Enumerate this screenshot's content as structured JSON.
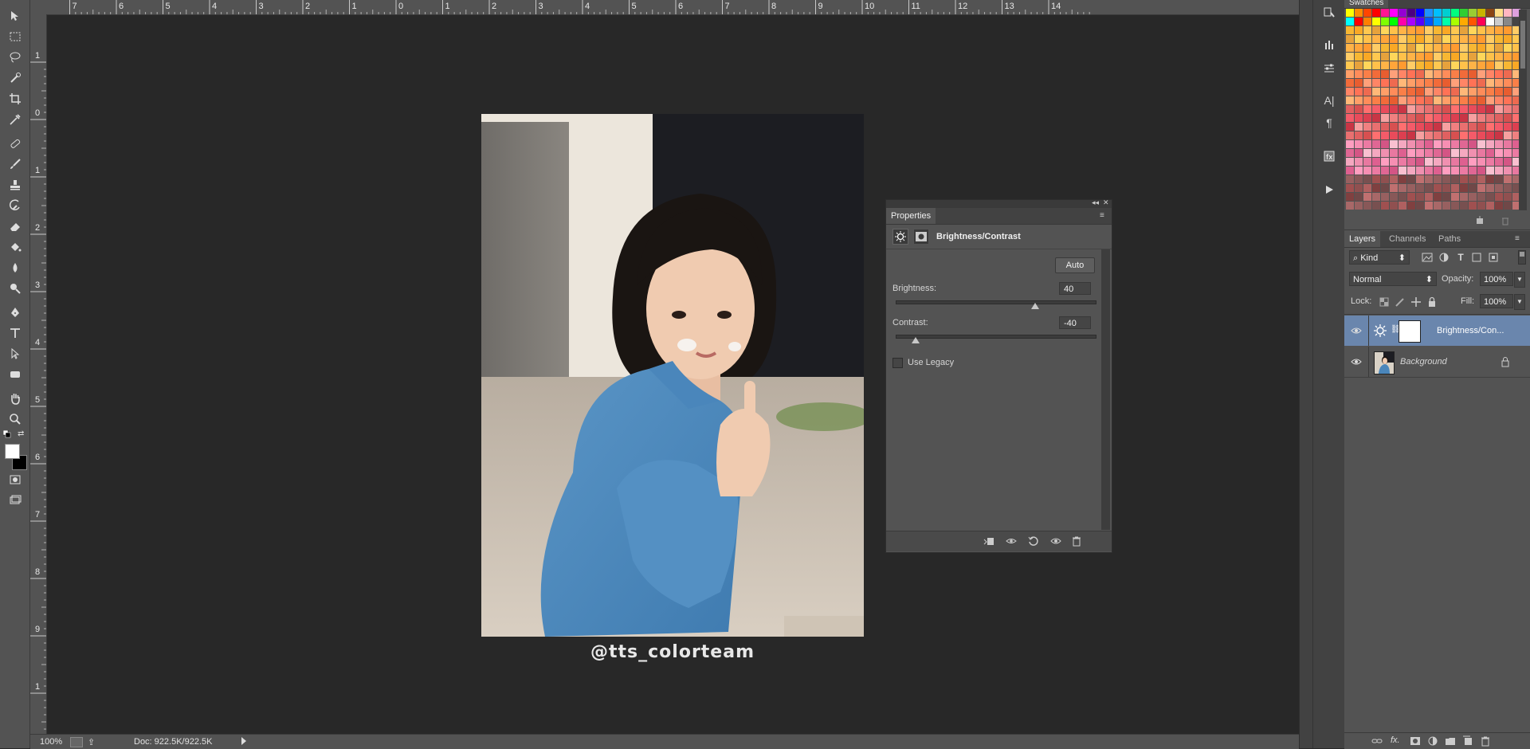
{
  "ruler": {
    "top_labels": [
      "7",
      "6",
      "5",
      "4",
      "3",
      "2",
      "1",
      "0",
      "1",
      "2",
      "3",
      "4",
      "5",
      "6",
      "7",
      "8",
      "9",
      "10",
      "11",
      "12",
      "13",
      "14"
    ],
    "left_labels": [
      "1",
      "0",
      "1",
      "2",
      "3",
      "4",
      "5",
      "6",
      "7",
      "8",
      "9",
      "1"
    ]
  },
  "canvas": {
    "watermark": "@tts_colorteam"
  },
  "status": {
    "zoom": "100%",
    "doc": "Doc: 922.5K/922.5K"
  },
  "swatches": {
    "title": "Swatches"
  },
  "properties": {
    "tab_label": "Properties",
    "adjustment_title": "Brightness/Contrast",
    "auto_label": "Auto",
    "brightness_label": "Brightness:",
    "brightness_value": "40",
    "brightness_fraction": 0.7,
    "contrast_label": "Contrast:",
    "contrast_value": "-40",
    "contrast_fraction": 0.1,
    "use_legacy_label": "Use Legacy",
    "use_legacy_checked": false
  },
  "layers": {
    "tabs": [
      "Layers",
      "Channels",
      "Paths"
    ],
    "filter_kind": "Kind",
    "blend_mode": "Normal",
    "opacity_label": "Opacity:",
    "opacity_value": "100%",
    "lock_label": "Lock:",
    "fill_label": "Fill:",
    "fill_value": "100%",
    "items": [
      {
        "name": "Brightness/Con...",
        "selected": true
      },
      {
        "name": "Background",
        "selected": false
      }
    ]
  },
  "colors": {
    "foreground": "#ffffff",
    "background": "#000000",
    "selected_layer": "#6a86ad"
  }
}
